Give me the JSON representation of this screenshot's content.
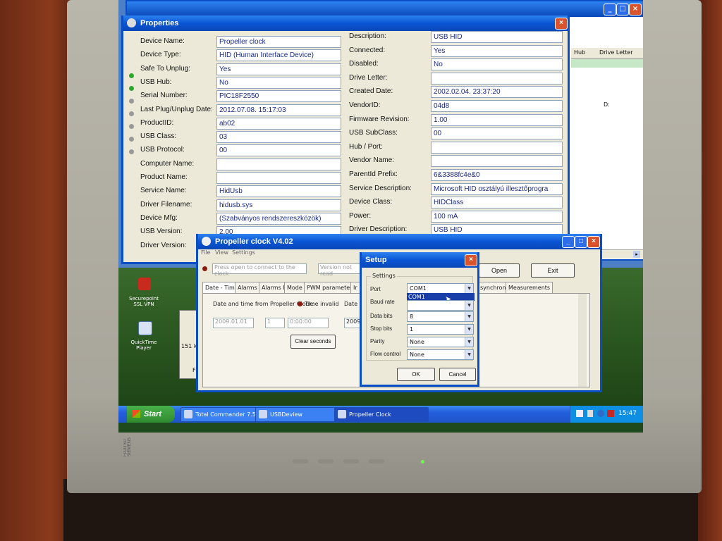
{
  "properties_window": {
    "title": "Properties",
    "left_fields": [
      {
        "label": "Device Name:",
        "value": "Propeller clock"
      },
      {
        "label": "Device Type:",
        "value": "HID (Human Interface Device)"
      },
      {
        "label": "Safe To Unplug:",
        "value": "Yes"
      },
      {
        "label": "USB Hub:",
        "value": "No"
      },
      {
        "label": "Serial Number:",
        "value": "PIC18F2550"
      },
      {
        "label": "Last Plug/Unplug Date:",
        "value": "2012.07.08. 15:17:03"
      },
      {
        "label": "ProductID:",
        "value": "ab02"
      },
      {
        "label": "USB Class:",
        "value": "03"
      },
      {
        "label": "USB Protocol:",
        "value": "00"
      },
      {
        "label": "Computer Name:",
        "value": ""
      },
      {
        "label": "Product Name:",
        "value": ""
      },
      {
        "label": "Service Name:",
        "value": "HidUsb"
      },
      {
        "label": "Driver Filename:",
        "value": "hidusb.sys"
      },
      {
        "label": "Device Mfg:",
        "value": "(Szabványos rendszereszközök)"
      },
      {
        "label": "USB Version:",
        "value": "2.00"
      },
      {
        "label": "Driver Version:",
        "value": ""
      }
    ],
    "right_fields": [
      {
        "label": "Description:",
        "value": "USB HID"
      },
      {
        "label": "Connected:",
        "value": "Yes"
      },
      {
        "label": "Disabled:",
        "value": "No"
      },
      {
        "label": "Drive Letter:",
        "value": ""
      },
      {
        "label": "Created Date:",
        "value": "2002.02.04. 23:37:20"
      },
      {
        "label": "VendorID:",
        "value": "04d8"
      },
      {
        "label": "Firmware Revision:",
        "value": "1.00"
      },
      {
        "label": "USB SubClass:",
        "value": "00"
      },
      {
        "label": "Hub / Port:",
        "value": ""
      },
      {
        "label": "Vendor Name:",
        "value": ""
      },
      {
        "label": "ParentId Prefix:",
        "value": "6&3388fc4e&0"
      },
      {
        "label": "Service Description:",
        "value": "Microsoft HID osztályú illesztőprogra"
      },
      {
        "label": "Device Class:",
        "value": "HIDClass"
      },
      {
        "label": "Power:",
        "value": "100 mA"
      },
      {
        "label": "Driver Description:",
        "value": "USB HID"
      }
    ]
  },
  "background_window": {
    "columns": [
      "Hub",
      "Drive Letter"
    ],
    "cell_value": "D:"
  },
  "propeller_window": {
    "title": "Propeller clock V4.02",
    "menu": [
      "File",
      "View",
      "Settings"
    ],
    "connect_placeholder": "Press open to connect to the clock",
    "version_placeholder": "Version not read",
    "open_label": "Open",
    "exit_label": "Exit",
    "tabs": [
      "Date - Time",
      "Alarms I",
      "Alarms II",
      "Mode",
      "PWM parameters",
      "Ir"
    ],
    "tabs_right": [
      "synchron",
      "Measurements"
    ],
    "date_time_label": "Date and time from Propeller Clock:",
    "time_status": "Time invalid",
    "date_label_short": "Date a",
    "date_value": "2009.01.01",
    "day_value": "1",
    "time_value": "0:00:00",
    "date_value_2": "2009",
    "clear_seconds_label": "Clear seconds"
  },
  "setup_dialog": {
    "title": "Setup",
    "group_label": "Settings",
    "fields": [
      {
        "label": "Port",
        "value": "COM1"
      },
      {
        "label": "Baud rate",
        "value": ""
      },
      {
        "label": "Data bits",
        "value": "8"
      },
      {
        "label": "Stop bits",
        "value": "1"
      },
      {
        "label": "Parity",
        "value": "None"
      },
      {
        "label": "Flow control",
        "value": "None"
      }
    ],
    "dropdown_option": "COM1",
    "ok_label": "OK",
    "cancel_label": "Cancel"
  },
  "desktop": {
    "icons": [
      {
        "label": "Securepoint SSL VPN"
      },
      {
        "label": "QuickTime Player"
      }
    ],
    "behind_text": "151 k",
    "behind_letter": "F"
  },
  "taskbar": {
    "start_label": "Start",
    "tasks": [
      "Total Commander 7.5...",
      "USBDeview",
      "Propeller Clock"
    ],
    "clock": "15:47"
  },
  "monitor": {
    "brand": "FUJITSU SIEMENS"
  }
}
